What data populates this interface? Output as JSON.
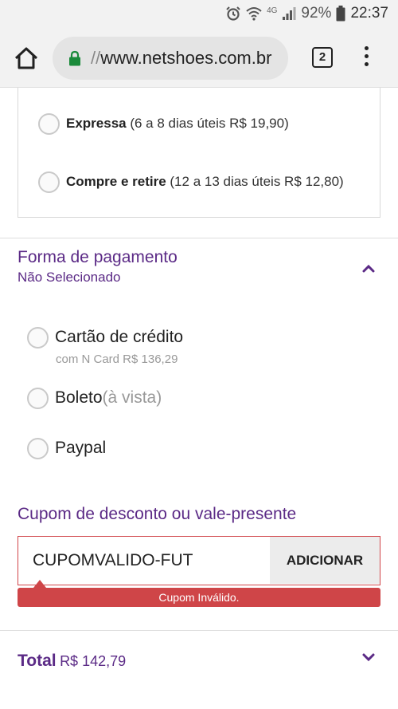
{
  "status_bar": {
    "battery": "92%",
    "time": "22:37",
    "network": "4G",
    "icons": [
      "alarm-icon",
      "wifi-icon",
      "signal-icon",
      "battery-icon"
    ]
  },
  "browser": {
    "url_slashes": "//",
    "url_host": "www.netshoes.com.br",
    "tab_count": "2",
    "icons": [
      "home-icon",
      "lock-icon",
      "tabs-icon",
      "menu-icon"
    ]
  },
  "shipping": {
    "options": [
      {
        "name": "Expressa",
        "detail": " (6 a 8 dias úteis R$ 19,90)"
      },
      {
        "name": "Compre e retire",
        "detail": " (12 a 13 dias úteis R$ 12,80)"
      }
    ]
  },
  "payment": {
    "title": "Forma de pagamento",
    "subtitle": "Não Selecionado",
    "options": [
      {
        "label": "Cartão de crédito",
        "note": "com N Card R$ 136,29"
      },
      {
        "label": "Boleto",
        "suffix": "(à vista)"
      },
      {
        "label": "Paypal"
      }
    ]
  },
  "coupon": {
    "title": "Cupom de desconto ou vale-presente",
    "value": "CUPOMVALIDO-FUT",
    "button": "ADICIONAR",
    "error": "Cupom Inválido."
  },
  "total": {
    "label": "Total",
    "value": "R$ 142,79"
  },
  "colors": {
    "accent": "#5b2a86",
    "error": "#cf4548",
    "lock": "#1a8a3a"
  }
}
